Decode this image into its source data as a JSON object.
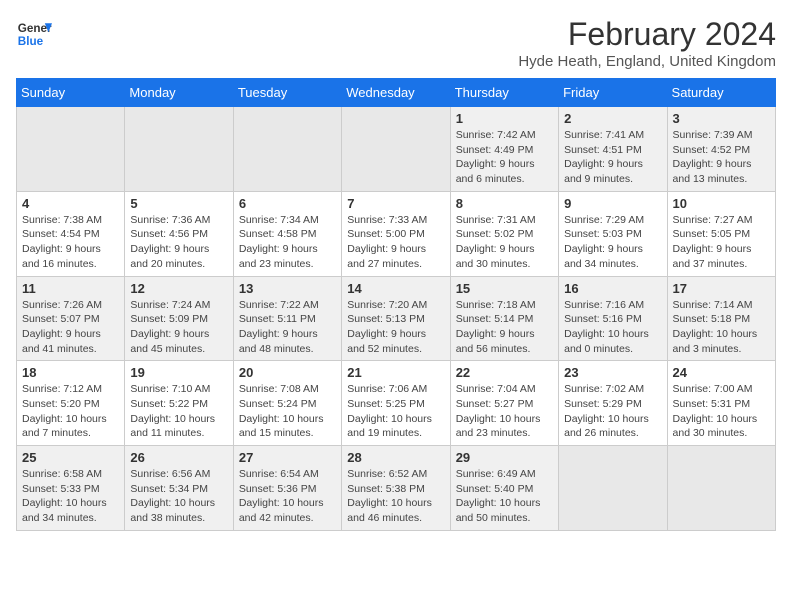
{
  "header": {
    "logo_line1": "General",
    "logo_line2": "Blue",
    "month_title": "February 2024",
    "location": "Hyde Heath, England, United Kingdom"
  },
  "weekdays": [
    "Sunday",
    "Monday",
    "Tuesday",
    "Wednesday",
    "Thursday",
    "Friday",
    "Saturday"
  ],
  "weeks": [
    [
      {
        "day": "",
        "info": ""
      },
      {
        "day": "",
        "info": ""
      },
      {
        "day": "",
        "info": ""
      },
      {
        "day": "",
        "info": ""
      },
      {
        "day": "1",
        "info": "Sunrise: 7:42 AM\nSunset: 4:49 PM\nDaylight: 9 hours\nand 6 minutes."
      },
      {
        "day": "2",
        "info": "Sunrise: 7:41 AM\nSunset: 4:51 PM\nDaylight: 9 hours\nand 9 minutes."
      },
      {
        "day": "3",
        "info": "Sunrise: 7:39 AM\nSunset: 4:52 PM\nDaylight: 9 hours\nand 13 minutes."
      }
    ],
    [
      {
        "day": "4",
        "info": "Sunrise: 7:38 AM\nSunset: 4:54 PM\nDaylight: 9 hours\nand 16 minutes."
      },
      {
        "day": "5",
        "info": "Sunrise: 7:36 AM\nSunset: 4:56 PM\nDaylight: 9 hours\nand 20 minutes."
      },
      {
        "day": "6",
        "info": "Sunrise: 7:34 AM\nSunset: 4:58 PM\nDaylight: 9 hours\nand 23 minutes."
      },
      {
        "day": "7",
        "info": "Sunrise: 7:33 AM\nSunset: 5:00 PM\nDaylight: 9 hours\nand 27 minutes."
      },
      {
        "day": "8",
        "info": "Sunrise: 7:31 AM\nSunset: 5:02 PM\nDaylight: 9 hours\nand 30 minutes."
      },
      {
        "day": "9",
        "info": "Sunrise: 7:29 AM\nSunset: 5:03 PM\nDaylight: 9 hours\nand 34 minutes."
      },
      {
        "day": "10",
        "info": "Sunrise: 7:27 AM\nSunset: 5:05 PM\nDaylight: 9 hours\nand 37 minutes."
      }
    ],
    [
      {
        "day": "11",
        "info": "Sunrise: 7:26 AM\nSunset: 5:07 PM\nDaylight: 9 hours\nand 41 minutes."
      },
      {
        "day": "12",
        "info": "Sunrise: 7:24 AM\nSunset: 5:09 PM\nDaylight: 9 hours\nand 45 minutes."
      },
      {
        "day": "13",
        "info": "Sunrise: 7:22 AM\nSunset: 5:11 PM\nDaylight: 9 hours\nand 48 minutes."
      },
      {
        "day": "14",
        "info": "Sunrise: 7:20 AM\nSunset: 5:13 PM\nDaylight: 9 hours\nand 52 minutes."
      },
      {
        "day": "15",
        "info": "Sunrise: 7:18 AM\nSunset: 5:14 PM\nDaylight: 9 hours\nand 56 minutes."
      },
      {
        "day": "16",
        "info": "Sunrise: 7:16 AM\nSunset: 5:16 PM\nDaylight: 10 hours\nand 0 minutes."
      },
      {
        "day": "17",
        "info": "Sunrise: 7:14 AM\nSunset: 5:18 PM\nDaylight: 10 hours\nand 3 minutes."
      }
    ],
    [
      {
        "day": "18",
        "info": "Sunrise: 7:12 AM\nSunset: 5:20 PM\nDaylight: 10 hours\nand 7 minutes."
      },
      {
        "day": "19",
        "info": "Sunrise: 7:10 AM\nSunset: 5:22 PM\nDaylight: 10 hours\nand 11 minutes."
      },
      {
        "day": "20",
        "info": "Sunrise: 7:08 AM\nSunset: 5:24 PM\nDaylight: 10 hours\nand 15 minutes."
      },
      {
        "day": "21",
        "info": "Sunrise: 7:06 AM\nSunset: 5:25 PM\nDaylight: 10 hours\nand 19 minutes."
      },
      {
        "day": "22",
        "info": "Sunrise: 7:04 AM\nSunset: 5:27 PM\nDaylight: 10 hours\nand 23 minutes."
      },
      {
        "day": "23",
        "info": "Sunrise: 7:02 AM\nSunset: 5:29 PM\nDaylight: 10 hours\nand 26 minutes."
      },
      {
        "day": "24",
        "info": "Sunrise: 7:00 AM\nSunset: 5:31 PM\nDaylight: 10 hours\nand 30 minutes."
      }
    ],
    [
      {
        "day": "25",
        "info": "Sunrise: 6:58 AM\nSunset: 5:33 PM\nDaylight: 10 hours\nand 34 minutes."
      },
      {
        "day": "26",
        "info": "Sunrise: 6:56 AM\nSunset: 5:34 PM\nDaylight: 10 hours\nand 38 minutes."
      },
      {
        "day": "27",
        "info": "Sunrise: 6:54 AM\nSunset: 5:36 PM\nDaylight: 10 hours\nand 42 minutes."
      },
      {
        "day": "28",
        "info": "Sunrise: 6:52 AM\nSunset: 5:38 PM\nDaylight: 10 hours\nand 46 minutes."
      },
      {
        "day": "29",
        "info": "Sunrise: 6:49 AM\nSunset: 5:40 PM\nDaylight: 10 hours\nand 50 minutes."
      },
      {
        "day": "",
        "info": ""
      },
      {
        "day": "",
        "info": ""
      }
    ]
  ]
}
